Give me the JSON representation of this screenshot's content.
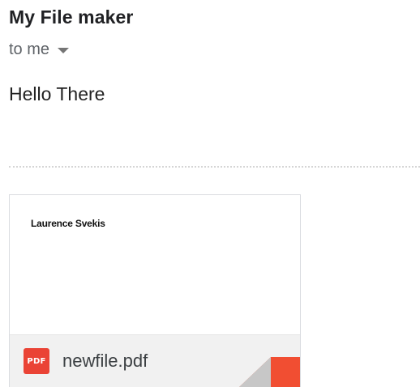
{
  "email": {
    "sender_name": "My File maker",
    "recipient": "to me",
    "body": "Hello There"
  },
  "attachment": {
    "preview_text": "Laurence Svekis",
    "file_type_label": "PDF",
    "file_name": "newfile.pdf",
    "type_icon": "pdf-icon",
    "accent_color": "#ea4335"
  }
}
